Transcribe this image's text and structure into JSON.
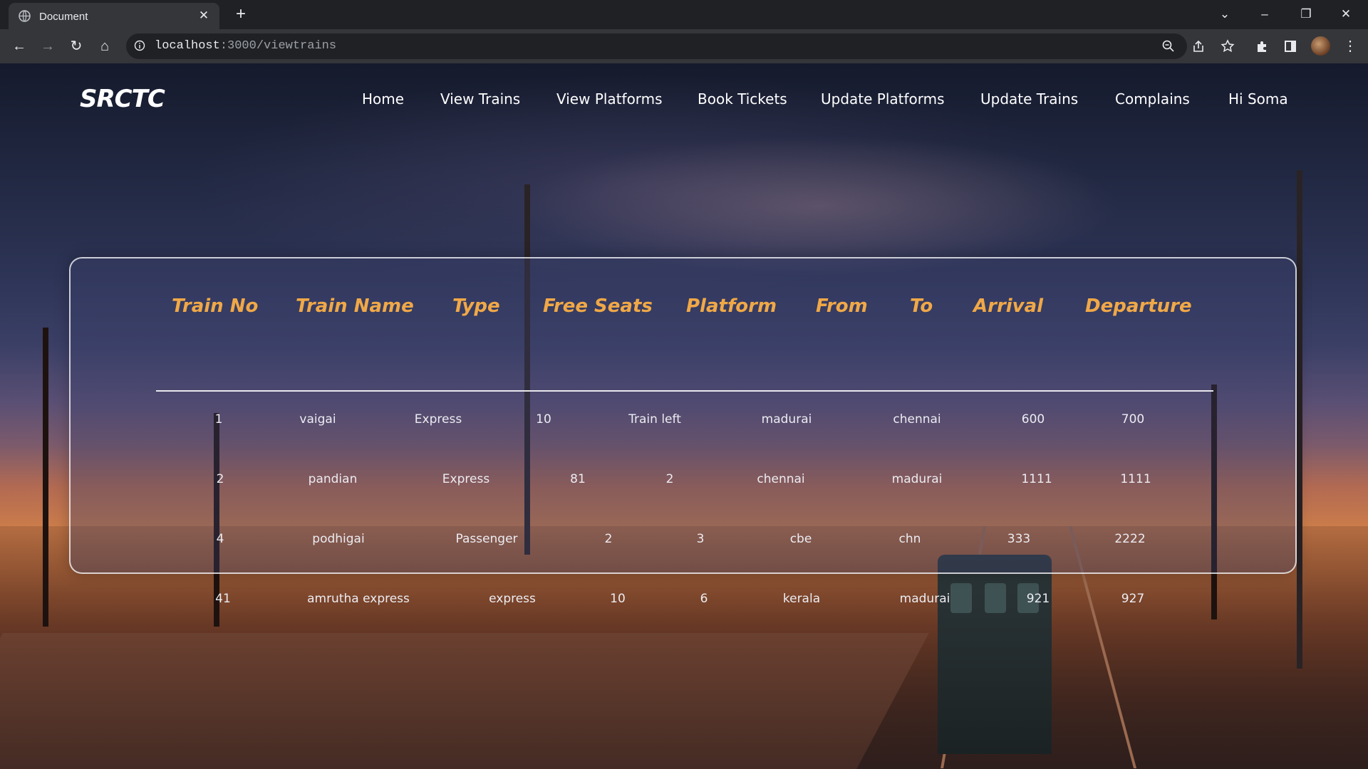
{
  "browser": {
    "tab_title": "Document",
    "url_host": "localhost",
    "url_path": ":3000/viewtrains"
  },
  "nav": {
    "logo": "SRCTC",
    "links": [
      "Home",
      "View Trains",
      "View Platforms",
      "Book Tickets",
      "Update Platforms",
      "Update Trains",
      "Complains",
      "Hi Soma"
    ]
  },
  "table": {
    "headers": [
      "Train No",
      "Train Name",
      "Type",
      "Free Seats",
      "Platform",
      "From",
      "To",
      "Arrival",
      "Departure"
    ],
    "rows": [
      [
        "1",
        "vaigai",
        "Express",
        "10",
        "Train left",
        "madurai",
        "chennai",
        "600",
        "700"
      ],
      [
        "2",
        "pandian",
        "Express",
        "81",
        "2",
        "chennai",
        "madurai",
        "1111",
        "1111"
      ],
      [
        "4",
        "podhigai",
        "Passenger",
        "2",
        "3",
        "cbe",
        "chn",
        "333",
        "2222"
      ],
      [
        "41",
        "amrutha express",
        "express",
        "10",
        "6",
        "kerala",
        "madurai",
        "921",
        "927"
      ]
    ]
  },
  "colors": {
    "header_accent": "#f0a847",
    "card_border": "#ffffff"
  },
  "icons": [
    "globe-icon",
    "close-icon",
    "plus-icon",
    "back-icon",
    "forward-icon",
    "reload-icon",
    "home-icon",
    "info-icon",
    "zoom-icon",
    "share-icon",
    "star-icon",
    "puzzle-icon",
    "sidepanel-icon",
    "menu-icon"
  ]
}
